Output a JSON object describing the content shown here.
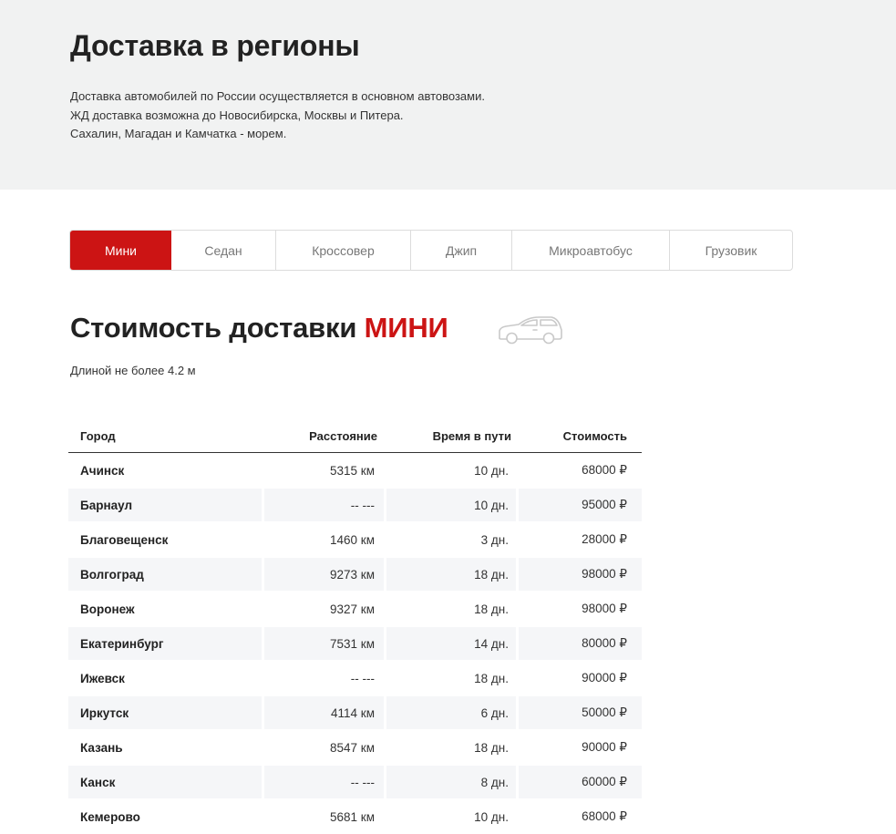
{
  "hero": {
    "title": "Доставка в регионы",
    "lines": [
      "Доставка автомобилей по России осуществляется в основном автовозами.",
      "ЖД доставка возможна до Новосибирска, Москвы и Питера.",
      "Сахалин, Магадан и Камчатка - морем."
    ]
  },
  "tabs": [
    {
      "label": "Мини",
      "active": true
    },
    {
      "label": "Седан",
      "active": false
    },
    {
      "label": "Кроссовер",
      "active": false
    },
    {
      "label": "Джип",
      "active": false
    },
    {
      "label": "Микроавтобус",
      "active": false
    },
    {
      "label": "Грузовик",
      "active": false
    }
  ],
  "section": {
    "title_prefix": "Стоимость доставки",
    "title_accent": "МИНИ",
    "subtitle": "Длиной не более 4.2 м",
    "icon": "car-icon"
  },
  "colors": {
    "accent": "#cc1414",
    "hero_bg": "#f1f2f2",
    "row_alt_bg": "#f5f6f8"
  },
  "table": {
    "headers": [
      "Город",
      "Расстояние",
      "Время в пути",
      "Стоимость"
    ],
    "rows": [
      [
        "Ачинск",
        "5315 км",
        "10 дн.",
        "68000 ₽"
      ],
      [
        "Барнаул",
        "-- ---",
        "10 дн.",
        "95000 ₽"
      ],
      [
        "Благовещенск",
        "1460 км",
        "3 дн.",
        "28000 ₽"
      ],
      [
        "Волгоград",
        "9273 км",
        "18 дн.",
        "98000 ₽"
      ],
      [
        "Воронеж",
        "9327 км",
        "18 дн.",
        "98000 ₽"
      ],
      [
        "Екатеринбург",
        "7531 км",
        "14 дн.",
        "80000 ₽"
      ],
      [
        "Ижевск",
        "-- ---",
        "18 дн.",
        "90000 ₽"
      ],
      [
        "Иркутск",
        "4114 км",
        "6 дн.",
        "50000 ₽"
      ],
      [
        "Казань",
        "8547 км",
        "18 дн.",
        "90000 ₽"
      ],
      [
        "Канск",
        "-- ---",
        "8 дн.",
        "60000 ₽"
      ],
      [
        "Кемерово",
        "5681 км",
        "10 дн.",
        "68000 ₽"
      ]
    ]
  }
}
